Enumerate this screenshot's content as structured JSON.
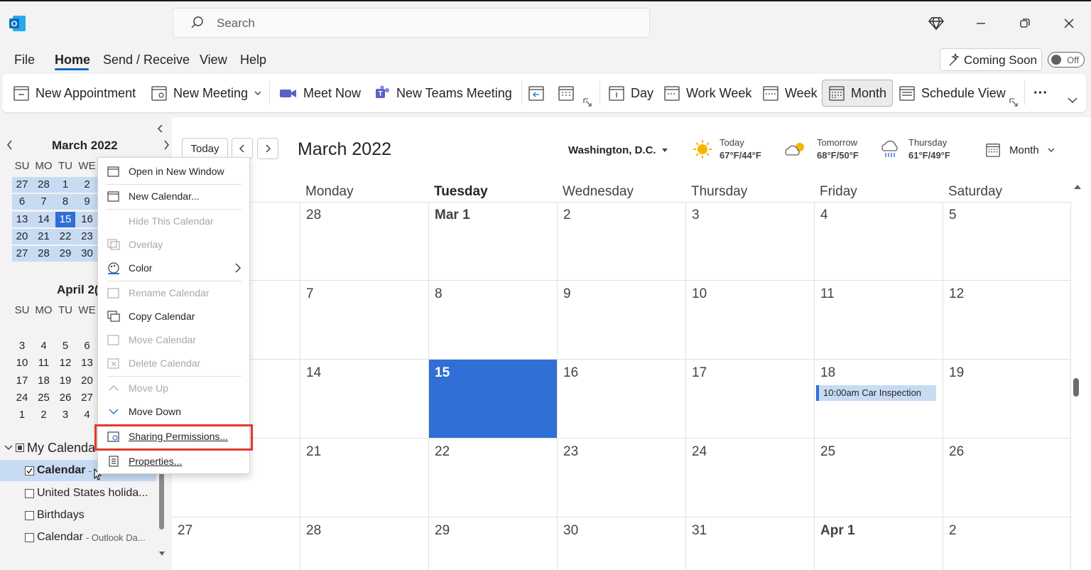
{
  "app": {
    "logo_letter": "O",
    "brand_color": "#0f6cbd"
  },
  "search": {
    "placeholder": "Search"
  },
  "menu": {
    "file": "File",
    "home": "Home",
    "send_receive": "Send / Receive",
    "view": "View",
    "help": "Help"
  },
  "coming_soon": {
    "label": "Coming Soon",
    "toggle": "Off"
  },
  "ribbon": {
    "new_appointment": "New Appointment",
    "new_meeting": "New Meeting",
    "meet_now": "Meet Now",
    "new_teams_meeting": "New Teams Meeting",
    "day": "Day",
    "work_week": "Work Week",
    "week": "Week",
    "month": "Month",
    "schedule_view": "Schedule View",
    "more": "···"
  },
  "mini_cal": {
    "march_title": "March 2022",
    "april_title": "April 2(",
    "weekdays": [
      "SU",
      "MO",
      "TU",
      "WE"
    ],
    "march_rows": [
      [
        "27",
        "28",
        "1",
        "2"
      ],
      [
        "6",
        "7",
        "8",
        "9"
      ],
      [
        "13",
        "14",
        "15",
        "16"
      ],
      [
        "20",
        "21",
        "22",
        "23"
      ],
      [
        "27",
        "28",
        "29",
        "30"
      ]
    ],
    "april_rows": [
      [
        "3",
        "4",
        "5",
        "6"
      ],
      [
        "10",
        "11",
        "12",
        "13"
      ],
      [
        "17",
        "18",
        "19",
        "20"
      ],
      [
        "24",
        "25",
        "26",
        "27"
      ],
      [
        "1",
        "2",
        "3",
        "4"
      ]
    ],
    "selected": "15"
  },
  "folders": {
    "group": "My Calenda",
    "calendar": "Calendar",
    "calendar_suffix": "-",
    "us_holidays": "United States holida...",
    "birthdays": "Birthdays",
    "calendar_outlook": "Calendar",
    "calendar_outlook_suffix": "- Outlook Da..."
  },
  "toolbar": {
    "today": "Today",
    "title": "March 2022",
    "location": "Washington, D.C.",
    "view": "Month"
  },
  "weather": [
    {
      "day": "Today",
      "temps": "67°F/44°F",
      "icon": "sun-icon"
    },
    {
      "day": "Tomorrow",
      "temps": "68°F/50°F",
      "icon": "partly-cloudy-icon"
    },
    {
      "day": "Thursday",
      "temps": "61°F/49°F",
      "icon": "rain-icon"
    }
  ],
  "calendar": {
    "day_headers": [
      "Monday",
      "Tuesday",
      "Wednesday",
      "Thursday",
      "Friday",
      "Saturday"
    ],
    "sunday_cells": [
      "",
      "",
      "",
      "",
      "27"
    ],
    "weeks": [
      [
        "28",
        "Mar 1",
        "2",
        "3",
        "4",
        "5"
      ],
      [
        "7",
        "8",
        "9",
        "10",
        "11",
        "12"
      ],
      [
        "14",
        "15",
        "16",
        "17",
        "18",
        "19"
      ],
      [
        "21",
        "22",
        "23",
        "24",
        "25",
        "26"
      ],
      [
        "28",
        "29",
        "30",
        "31",
        "Apr 1",
        "2"
      ]
    ],
    "event": "10:00am Car Inspection",
    "today_color": "#2f6fd6"
  },
  "context_menu": {
    "open_new_window": "Open in New Window",
    "new_calendar": "New Calendar...",
    "hide_calendar": "Hide This Calendar",
    "overlay": "Overlay",
    "color": "Color",
    "rename_calendar": "Rename Calendar",
    "copy_calendar": "Copy Calendar",
    "move_calendar": "Move Calendar",
    "delete_calendar": "Delete Calendar",
    "move_up": "Move Up",
    "move_down": "Move Down",
    "sharing_permissions": "Sharing Permissions...",
    "properties": "Properties...",
    "highlight_color": "#e03a2d"
  }
}
